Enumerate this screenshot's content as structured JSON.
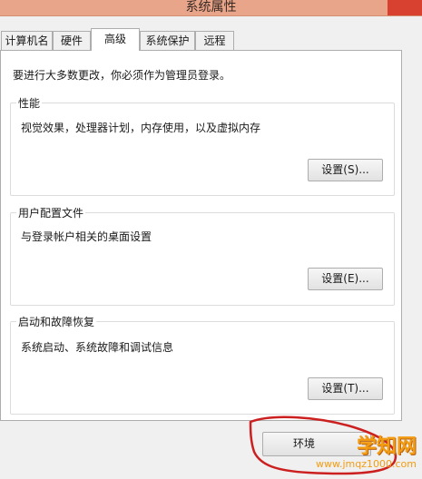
{
  "window": {
    "title": "系统属性"
  },
  "tabs": [
    {
      "label": "计算机名"
    },
    {
      "label": "硬件"
    },
    {
      "label": "高级",
      "active": true
    },
    {
      "label": "系统保护"
    },
    {
      "label": "远程"
    }
  ],
  "notice": "要进行大多数更改，你必须作为管理员登录。",
  "groups": {
    "performance": {
      "title": "性能",
      "description": "视觉效果，处理器计划，内存使用，以及虚拟内存",
      "button": "设置(S)..."
    },
    "profiles": {
      "title": "用户配置文件",
      "description": "与登录帐户相关的桌面设置",
      "button": "设置(E)..."
    },
    "startup": {
      "title": "启动和故障恢复",
      "description": "系统启动、系统故障和调试信息",
      "button": "设置(T)..."
    }
  },
  "env_button": {
    "label": "环境"
  },
  "watermark": {
    "logo": "学知网",
    "url": "www.jmqz1000.com"
  },
  "colors": {
    "titlebar": "#e8a58a",
    "annotation": "#cc1f1f",
    "watermark": "#f39c12"
  }
}
